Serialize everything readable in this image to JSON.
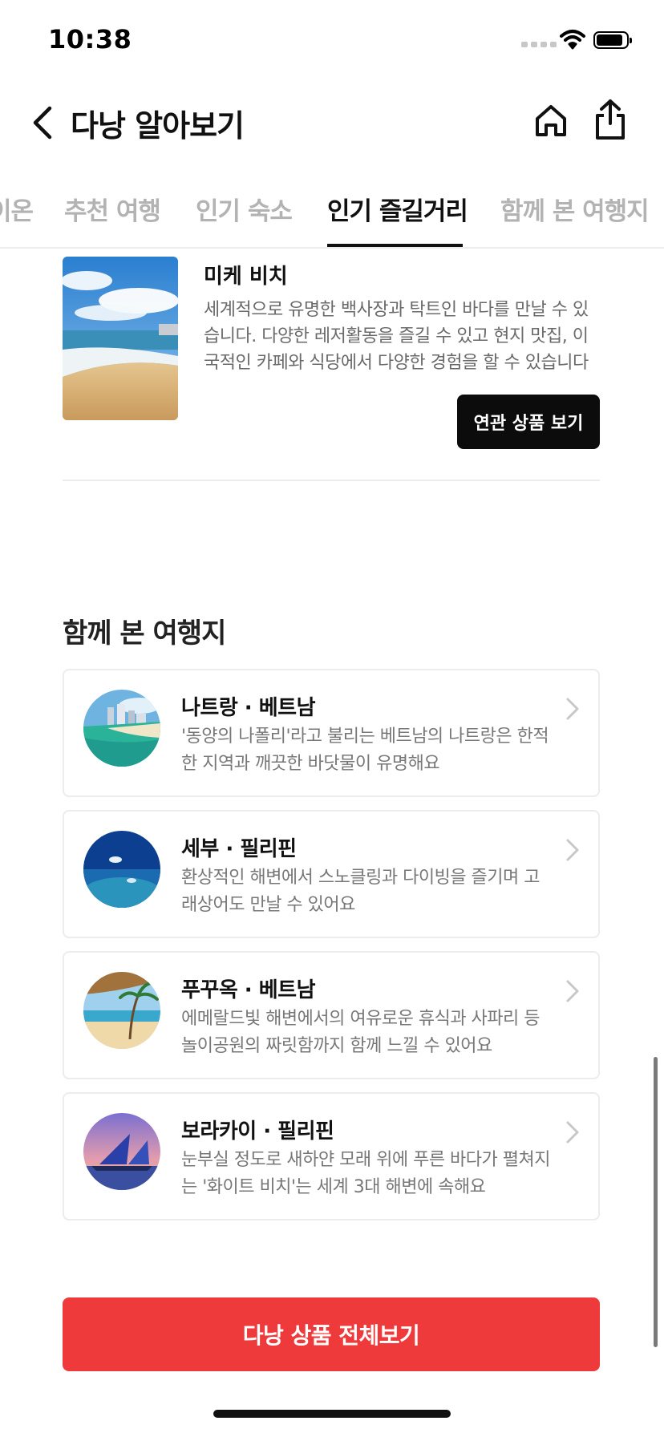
{
  "status_bar": {
    "time": "10:38"
  },
  "header": {
    "title": "다낭 알아보기"
  },
  "tabs": [
    {
      "label": "이온"
    },
    {
      "label": "추천 여행"
    },
    {
      "label": "인기 숙소"
    },
    {
      "label": "인기 즐길거리",
      "active": true
    },
    {
      "label": "함께 본 여행지"
    }
  ],
  "activity": {
    "title": "미케 비치",
    "description": "세계적으로 유명한 백사장과 탁트인 바다를 만날 수 있습니다. 다양한 레저활동을 즐길 수 있고 현지 맛집, 이국적인 카페와 식당에서 다양한 경험을 할 수 있습니다",
    "button_label": "연관 상품 보기"
  },
  "related_section": {
    "title": "함께 본 여행지",
    "destinations": [
      {
        "name": "나트랑 · 베트남",
        "description": "'동양의 나폴리'라고 불리는 베트남의 나트랑은 한적한 지역과 깨끗한 바닷물이 유명해요"
      },
      {
        "name": "세부 · 필리핀",
        "description": "환상적인 해변에서 스노클링과 다이빙을 즐기며 고래상어도 만날 수 있어요"
      },
      {
        "name": "푸꾸옥 · 베트남",
        "description": "에메랄드빛 해변에서의 여유로운 휴식과 사파리 등 놀이공원의 짜릿함까지 함께 느낄 수 있어요"
      },
      {
        "name": "보라카이 · 필리핀",
        "description": "눈부실 정도로 새하얀 모래 위에 푸른 바다가 펼쳐지는 '화이트 비치'는 세계 3대 해변에 속해요"
      }
    ]
  },
  "cta": {
    "label": "다낭 상품 전체보기"
  },
  "colors": {
    "accent": "#ef3a3b",
    "text": "#111111",
    "muted": "#777777"
  }
}
